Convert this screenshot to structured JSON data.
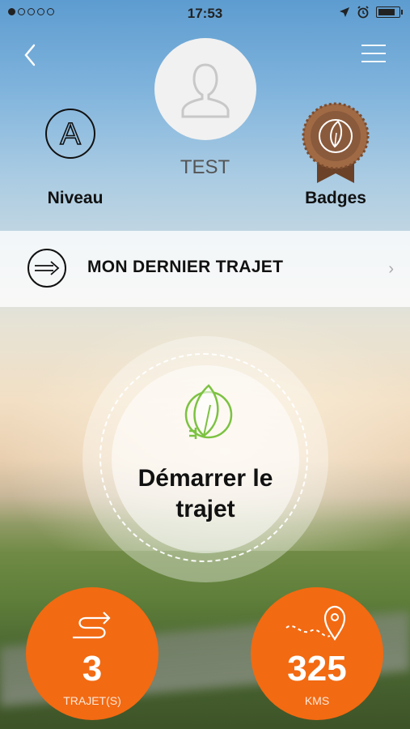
{
  "status_bar": {
    "time": "17:53",
    "signal_dots": 5
  },
  "profile": {
    "username": "TEST"
  },
  "niveau": {
    "label": "Niveau",
    "icon_letter": "A"
  },
  "badges": {
    "label": "Badges"
  },
  "last_trip": {
    "label": "MON DERNIER TRAJET"
  },
  "start": {
    "label_line1": "Démarrer le",
    "label_line2": "trajet"
  },
  "stats": {
    "trips": {
      "value": "3",
      "unit": "TRAJET(S)"
    },
    "distance": {
      "value": "325",
      "unit": "KMS"
    }
  },
  "colors": {
    "accent": "#f26a12",
    "leaf": "#7cc242",
    "badge": "#8a5a3c"
  }
}
